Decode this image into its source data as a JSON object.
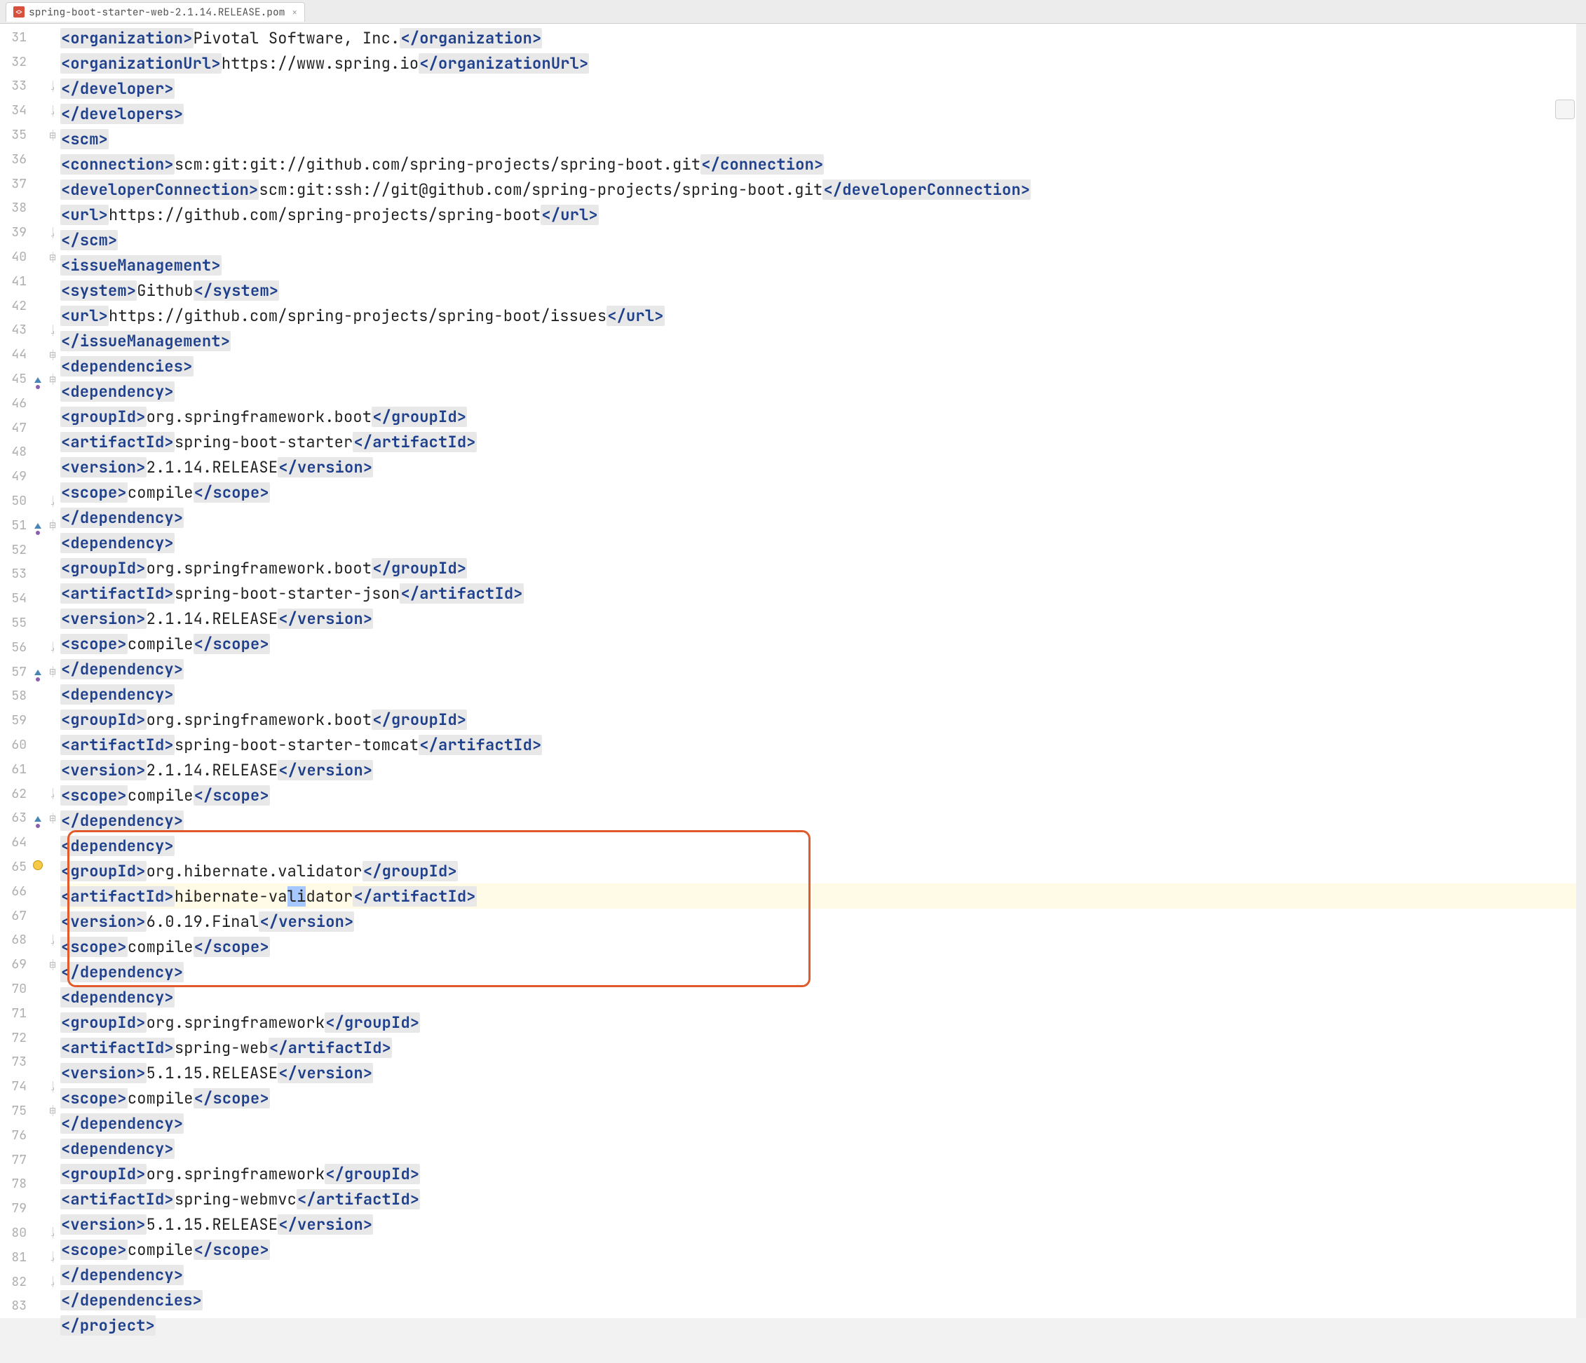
{
  "tab": {
    "filename": "spring-boot-starter-web-2.1.14.RELEASE.pom"
  },
  "gutter": {
    "start": 31,
    "end": 83,
    "markers": {
      "45": "up-override",
      "51": "up-override",
      "57": "up-override",
      "63": "up-override",
      "65": "bulb"
    }
  },
  "selection": {
    "line": 65,
    "text": "li"
  },
  "highlight_box": {
    "from_line": 63,
    "to_line": 68
  },
  "code": {
    "31": [
      6,
      "t",
      "organization",
      "Pivotal Software, Inc.",
      "organization"
    ],
    "32": [
      6,
      "f",
      "organizationUrl",
      "https://www.spring.io",
      "organizationUrl"
    ],
    "33": [
      5,
      "c",
      "developer"
    ],
    "34": [
      4,
      "c",
      "developers"
    ],
    "35": [
      4,
      "o",
      "scm"
    ],
    "36": [
      5,
      "f",
      "connection",
      "scm:git:git://github.com/spring-projects/spring-boot.git",
      "connection"
    ],
    "37": [
      5,
      "f",
      "developerConnection",
      "scm:git:ssh://git@github.com/spring-projects/spring-boot.git",
      "developerConnection"
    ],
    "38": [
      5,
      "f",
      "url",
      "https://github.com/spring-projects/spring-boot",
      "url"
    ],
    "39": [
      4,
      "c",
      "scm"
    ],
    "40": [
      4,
      "o",
      "issueManagement"
    ],
    "41": [
      5,
      "f",
      "system",
      "Github",
      "system"
    ],
    "42": [
      5,
      "f",
      "url",
      "https://github.com/spring-projects/spring-boot/issues",
      "url"
    ],
    "43": [
      4,
      "c",
      "issueManagement"
    ],
    "44": [
      4,
      "o",
      "dependencies"
    ],
    "45": [
      5,
      "o",
      "dependency"
    ],
    "46": [
      6,
      "f",
      "groupId",
      "org.springframework.boot",
      "groupId"
    ],
    "47": [
      6,
      "f",
      "artifactId",
      "spring-boot-starter",
      "artifactId"
    ],
    "48": [
      6,
      "f",
      "version",
      "2.1.14.RELEASE",
      "version"
    ],
    "49": [
      6,
      "f",
      "scope",
      "compile",
      "scope"
    ],
    "50": [
      5,
      "c",
      "dependency"
    ],
    "51": [
      5,
      "o",
      "dependency"
    ],
    "52": [
      6,
      "f",
      "groupId",
      "org.springframework.boot",
      "groupId"
    ],
    "53": [
      6,
      "f",
      "artifactId",
      "spring-boot-starter-json",
      "artifactId"
    ],
    "54": [
      6,
      "f",
      "version",
      "2.1.14.RELEASE",
      "version"
    ],
    "55": [
      6,
      "f",
      "scope",
      "compile",
      "scope"
    ],
    "56": [
      5,
      "c",
      "dependency"
    ],
    "57": [
      5,
      "o",
      "dependency"
    ],
    "58": [
      6,
      "f",
      "groupId",
      "org.springframework.boot",
      "groupId"
    ],
    "59": [
      6,
      "f",
      "artifactId",
      "spring-boot-starter-tomcat",
      "artifactId"
    ],
    "60": [
      6,
      "f",
      "version",
      "2.1.14.RELEASE",
      "version"
    ],
    "61": [
      6,
      "f",
      "scope",
      "compile",
      "scope"
    ],
    "62": [
      5,
      "c",
      "dependency"
    ],
    "63": [
      5,
      "o",
      "dependency"
    ],
    "64": [
      6,
      "f",
      "groupId",
      "org.hibernate.validator",
      "groupId"
    ],
    "65": [
      6,
      "f",
      "artifactId",
      "hibernate-validator",
      "artifactId"
    ],
    "66": [
      6,
      "f",
      "version",
      "6.0.19.Final",
      "version"
    ],
    "67": [
      6,
      "f",
      "scope",
      "compile",
      "scope"
    ],
    "68": [
      5,
      "c",
      "dependency"
    ],
    "69": [
      5,
      "o",
      "dependency"
    ],
    "70": [
      6,
      "f",
      "groupId",
      "org.springframework",
      "groupId"
    ],
    "71": [
      6,
      "f",
      "artifactId",
      "spring-web",
      "artifactId"
    ],
    "72": [
      6,
      "f",
      "version",
      "5.1.15.RELEASE",
      "version"
    ],
    "73": [
      6,
      "f",
      "scope",
      "compile",
      "scope"
    ],
    "74": [
      5,
      "c",
      "dependency"
    ],
    "75": [
      5,
      "o",
      "dependency"
    ],
    "76": [
      6,
      "f",
      "groupId",
      "org.springframework",
      "groupId"
    ],
    "77": [
      6,
      "f",
      "artifactId",
      "spring-webmvc",
      "artifactId"
    ],
    "78": [
      6,
      "f",
      "version",
      "5.1.15.RELEASE",
      "version"
    ],
    "79": [
      6,
      "f",
      "scope",
      "compile",
      "scope"
    ],
    "80": [
      5,
      "c",
      "dependency"
    ],
    "81": [
      4,
      "c",
      "dependencies"
    ],
    "82": [
      3,
      "c",
      "project"
    ],
    "83": [
      0,
      "e"
    ]
  },
  "watermark": ""
}
